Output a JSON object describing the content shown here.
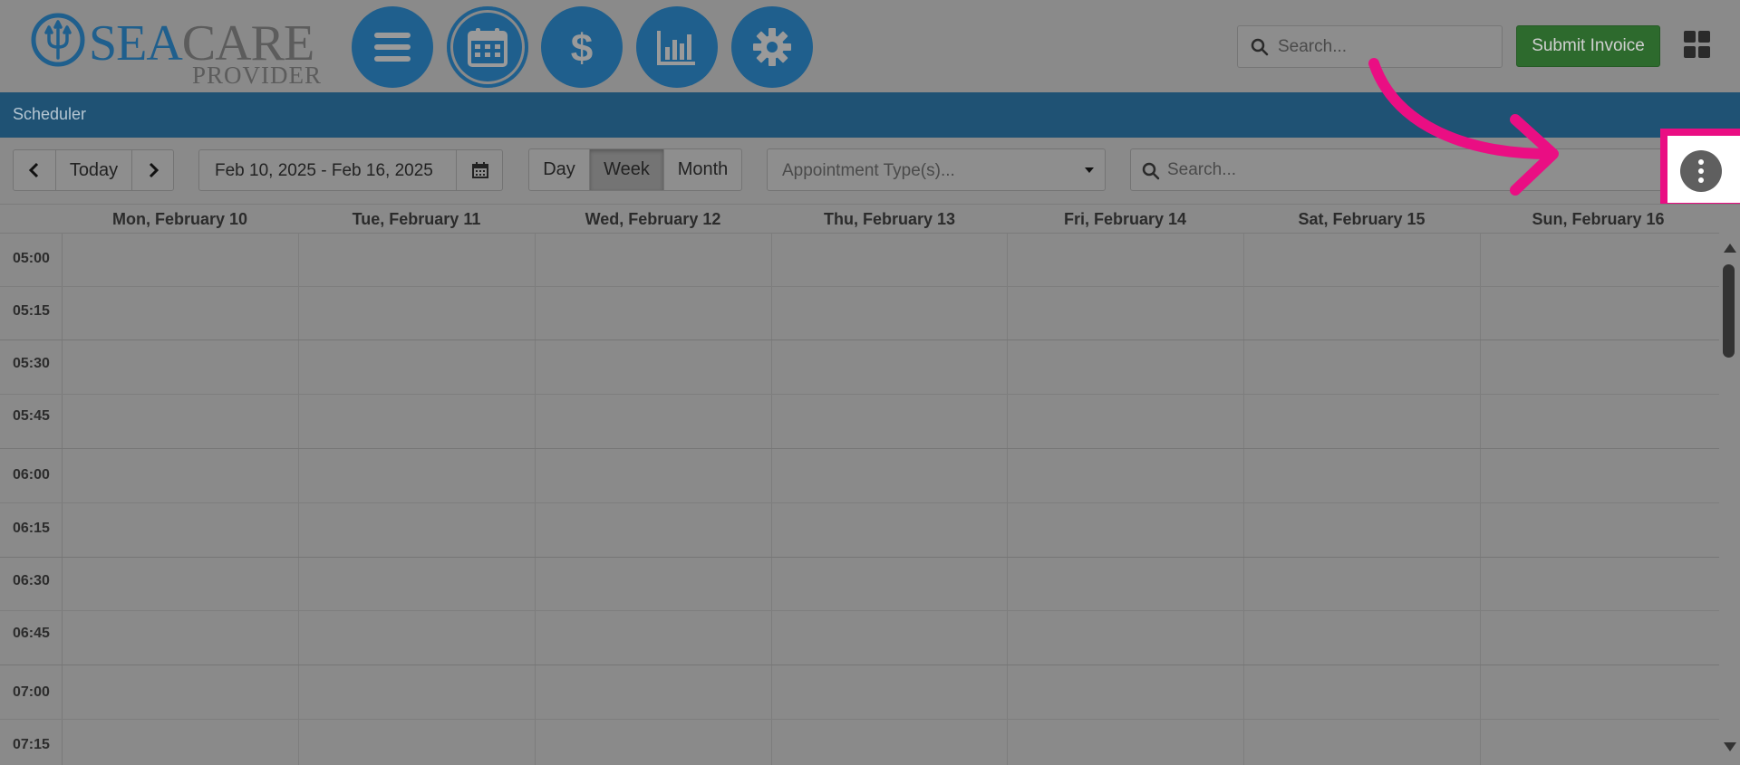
{
  "logo": {
    "brand_a": "SEA",
    "brand_b": "CARE",
    "sub": "PROVIDER"
  },
  "nav": [
    {
      "name": "menu-icon"
    },
    {
      "name": "calendar-icon"
    },
    {
      "name": "dollar-icon"
    },
    {
      "name": "bar-chart-icon"
    },
    {
      "name": "gear-icon"
    }
  ],
  "header": {
    "search_placeholder": "Search...",
    "submit_label": "Submit Invoice"
  },
  "page": {
    "title": "Scheduler"
  },
  "toolbar": {
    "today_label": "Today",
    "date_range": "Feb 10, 2025 - Feb 16, 2025",
    "views": [
      "Day",
      "Week",
      "Month"
    ],
    "active_view": "Week",
    "appointment_placeholder": "Appointment Type(s)...",
    "search_placeholder": "Search..."
  },
  "days": [
    "Mon, February 10",
    "Tue, February 11",
    "Wed, February 12",
    "Thu, February 13",
    "Fri, February 14",
    "Sat, February 15",
    "Sun, February 16"
  ],
  "times": [
    "05:00",
    "05:15",
    "05:30",
    "05:45",
    "06:00",
    "06:15",
    "06:30",
    "06:45",
    "07:00",
    "07:15"
  ],
  "colors": {
    "brand_blue": "#1f5f8d",
    "title_bar": "#1f5274",
    "submit_green": "#2d6a2d",
    "highlight_pink": "#ea0e83"
  }
}
